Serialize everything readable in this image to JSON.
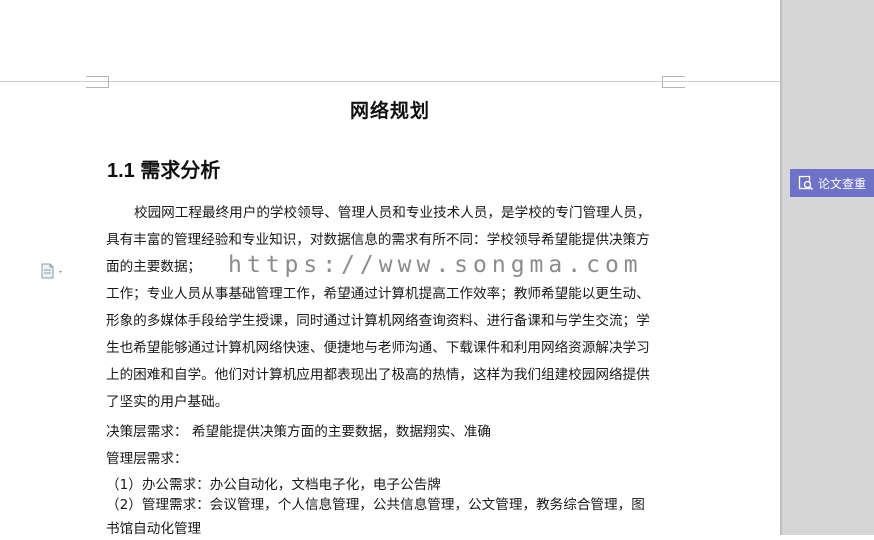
{
  "document": {
    "title": "网络规划",
    "section_heading": "1.1 需求分析",
    "paragraph_lines": [
      "校园网工程最终用户的学校领导、管理人员和专业技术人员，是学校的专门管理人员，",
      "具有丰富的管理经验和专业知识，对数据信息的需求有所不同：学校领导希望能提供决策方",
      "面的主要数据；",
      "工作；专业人员从事基础管理工作，希望通过计算机提高工作效率；教师希望能以更生动、",
      "形象的多媒体手段给学生授课，同时通过计算机网络查询资料、进行备课和与学生交流；学",
      "生也希望能够通过计算机网络快速、便捷地与老师沟通、下载课件和利用网络资源解决学习",
      "上的困难和自学。他们对计算机应用都表现出了极高的热情，这样为我们组建校园网络提供",
      "了坚实的用户基础。"
    ],
    "decision_need": "决策层需求：  希望能提供决策方面的主要数据，数据翔实、准确",
    "management_need": "管理层需求：",
    "item_1": "（1）办公需求：办公自动化，文档电子化，电子公告牌",
    "item_2": "（2）管理需求：会议管理，个人信息管理，公共信息管理，公文管理，教务综合管理，图",
    "item_2_cont": "书馆自动化管理"
  },
  "watermark": "https://www.songma.com",
  "sidebar": {
    "plagiarism_check_label": "论文查重"
  },
  "colors": {
    "accent": "#6f72c9",
    "sidebar_bg": "#d6d6d6"
  },
  "icons": {
    "doc": "document-icon",
    "check": "plagiarism-check-icon"
  }
}
